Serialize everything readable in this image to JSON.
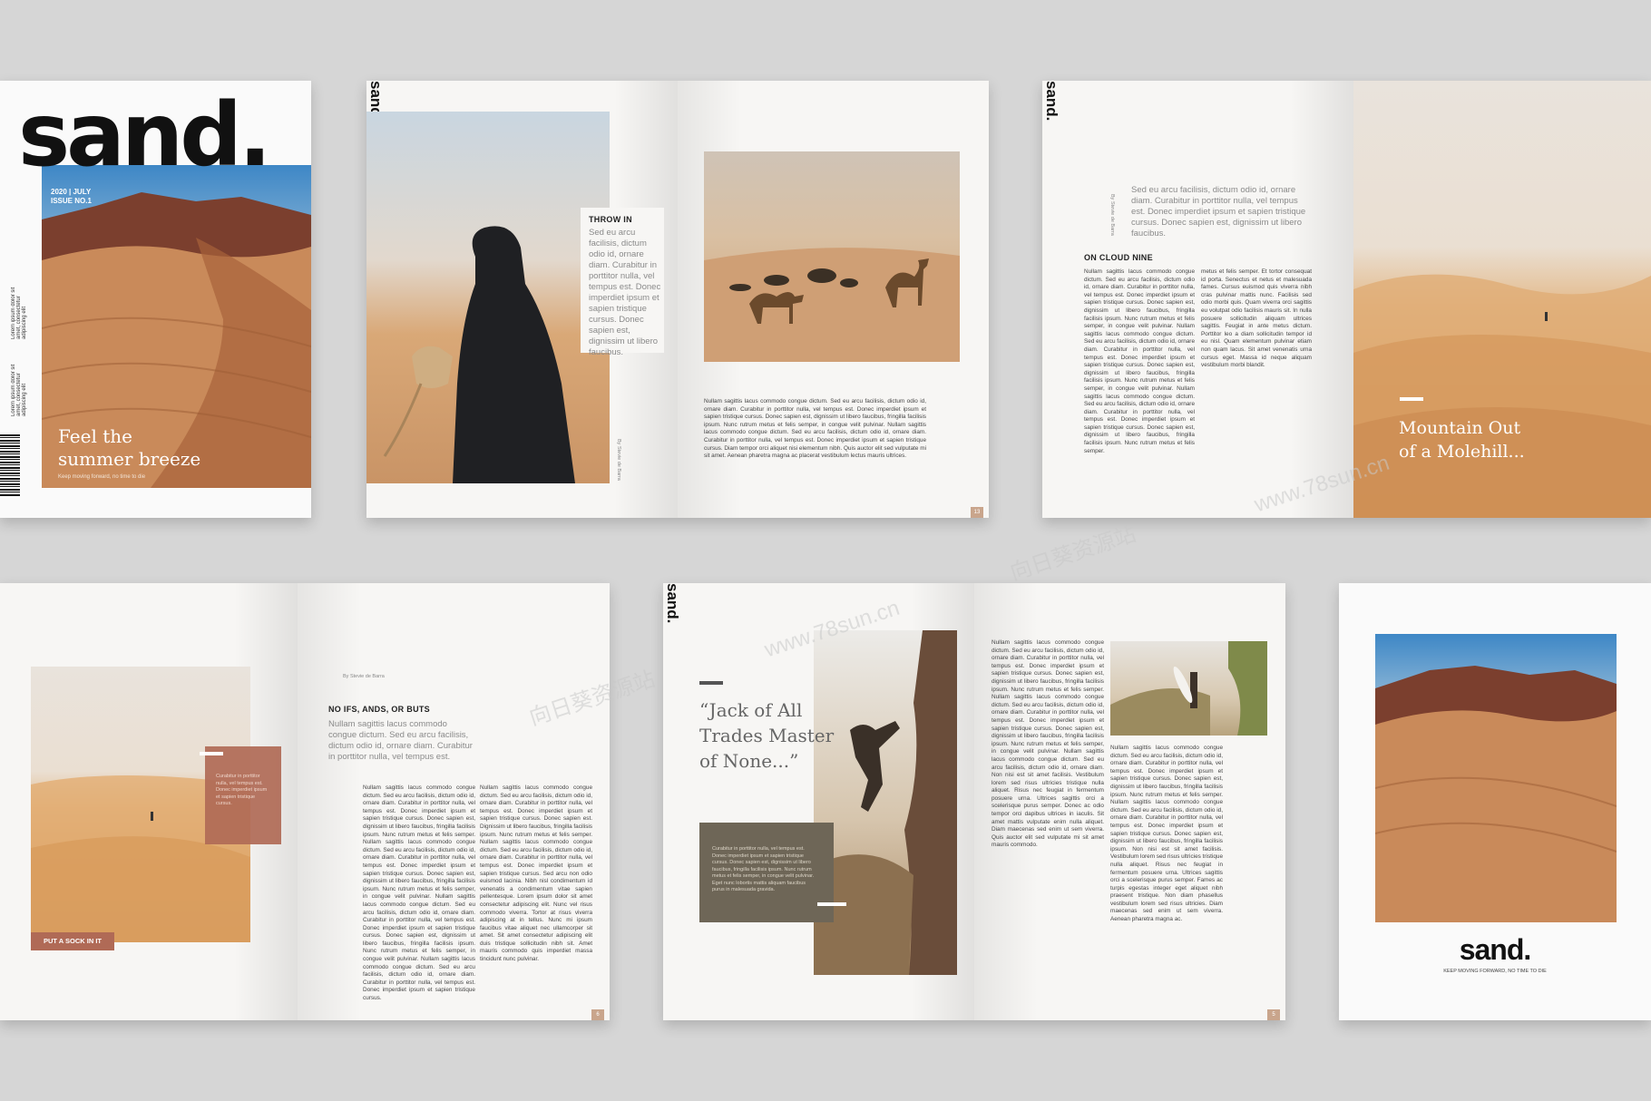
{
  "cover": {
    "masthead": "sand.",
    "issue_line1": "2020 | JULY",
    "issue_line2": "ISSUE NO.1",
    "side_text_1": "Lorem ipsum dolor sit amet, consectetur adipiscing elit",
    "side_text_2": "Lorem ipsum dolor sit amet, consectetur adipiscing elit",
    "headline_line1": "Feel the",
    "headline_line2": "summer breeze",
    "tagline": "Keep moving forward, no time to die"
  },
  "spread1": {
    "spine_logo": "sand.",
    "label": "THROW IN",
    "quote": "Sed eu arcu facilisis, dictum odio id, ornare diam. Curabitur in porttitor nulla, vel tempus est. Donec imperdiet ipsum et sapien tristique cursus. Donec sapien est, dignissim ut libero faucibus.",
    "credit": "By Stevie de Barra",
    "body": "Nullam sagittis lacus commodo congue dictum. Sed eu arcu facilisis, dictum odio id, ornare diam. Curabitur in porttitor nulla, vel tempus est. Donec imperdiet ipsum et sapien tristique cursus. Donec sapien est, dignissim ut libero faucibus, fringilla facilisis ipsum. Nunc rutrum metus et felis semper, in congue velit pulvinar. Nullam sagittis lacus commodo congue dictum. Sed eu arcu facilisis, dictum odio id, ornare diam. Curabitur in porttitor nulla, vel tempus est. Donec imperdiet ipsum et sapien tristique cursus. Diam tempor orci aliquet nisi elementum nibh. Quis auctor elit sed vulputate mi sit amet. Aenean pharetra magna ac placerat vestibulum lectus mauris ultrices.",
    "page_number": "13"
  },
  "spread2": {
    "spine_logo": "sand.",
    "credit": "By Stevie de Barra",
    "intro": "Sed eu arcu facilisis, dictum odio id, ornare diam. Curabitur in porttitor nulla, vel tempus est. Donec imperdiet ipsum et sapien tristique cursus. Donec sapien est, dignissim ut libero faucibus.",
    "label": "ON CLOUD NINE",
    "body_col1": "Nullam sagittis lacus commodo congue dictum. Sed eu arcu facilisis, dictum odio id, ornare diam. Curabitur in porttitor nulla, vel tempus est. Donec imperdiet ipsum et sapien tristique cursus. Donec sapien est, dignissim ut libero faucibus, fringilla facilisis ipsum. Nunc rutrum metus et felis semper, in congue velit pulvinar. Nullam sagittis lacus commodo congue dictum. Sed eu arcu facilisis, dictum odio id, ornare diam. Curabitur in porttitor nulla, vel tempus est. Donec imperdiet ipsum et sapien tristique cursus. Donec sapien est, dignissim ut libero faucibus, fringilla facilisis ipsum. Nunc rutrum metus et felis semper, in congue velit pulvinar. Nullam sagittis lacus commodo congue dictum. Sed eu arcu facilisis, dictum odio id, ornare diam. Curabitur in porttitor nulla, vel tempus est. Donec imperdiet ipsum et sapien tristique cursus. Donec sapien est, dignissim ut libero faucibus, fringilla facilisis ipsum. Nunc rutrum metus et felis semper.",
    "body_col2": "metus et felis semper. Et tortor consequat id porta. Senectus et netus et malesuada fames. Cursus euismod quis viverra nibh cras pulvinar mattis nunc. Facilisis sed odio morbi quis. Quam viverra orci sagittis eu volutpat odio facilisis mauris sit. In nulla posuere sollicitudin aliquam ultrices sagittis. Feugiat in ante metus dictum. Porttitor leo a diam sollicitudin tempor id eu nisl. Quam elementum pulvinar etiam non quam lacus. Sit amet venenatis urna cursus eget. Massa id neque aliquam vestibulum morbi blandit.",
    "headline_line1": "Mountain Out",
    "headline_line2": "of a Molehill..."
  },
  "spread3": {
    "credit": "By Stevie de Barra",
    "label": "NO IFS, ANDS, OR BUTS",
    "intro": "Nullam sagittis lacus commodo congue dictum. Sed eu arcu facilisis, dictum odio id, ornare diam. Curabitur in porttitor nulla, vel tempus est.",
    "caption": "Curabitur in porttitor nulla, vel tempus est. Donec imperdiet ipsum et sapien tristique cursus.",
    "button": "PUT A SOCK IN IT",
    "body_col1": "Nullam sagittis lacus commodo congue dictum. Sed eu arcu facilisis, dictum odio id, ornare diam. Curabitur in porttitor nulla, vel tempus est. Donec imperdiet ipsum et sapien tristique cursus. Donec sapien est, dignissim ut libero faucibus, fringilla facilisis ipsum. Nunc rutrum metus et felis semper. Nullam sagittis lacus commodo congue dictum. Sed eu arcu facilisis, dictum odio id, ornare diam. Curabitur in porttitor nulla, vel tempus est. Donec imperdiet ipsum et sapien tristique cursus. Donec sapien est, dignissim ut libero faucibus, fringilla facilisis ipsum. Nunc rutrum metus et felis semper, in congue velit pulvinar. Nullam sagittis lacus commodo congue dictum. Sed eu arcu facilisis, dictum odio id, ornare diam. Curabitur in porttitor nulla, vel tempus est. Donec imperdiet ipsum et sapien tristique cursus. Donec sapien est, dignissim ut libero faucibus, fringilla facilisis ipsum. Nunc rutrum metus et felis semper, in congue velit pulvinar. Nullam sagittis lacus commodo congue dictum. Sed eu arcu facilisis, dictum odio id, ornare diam. Curabitur in porttitor nulla, vel tempus est. Donec imperdiet ipsum et sapien tristique cursus.",
    "body_col2": "Nullam sagittis lacus commodo congue dictum. Sed eu arcu facilisis, dictum odio id, ornare diam. Curabitur in porttitor nulla, vel tempus est. Donec imperdiet ipsum et sapien tristique cursus. Donec sapien est. Dignissim ut libero faucibus, fringilla facilisis ipsum. Nunc rutrum metus et felis semper. Nullam sagittis lacus commodo congue dictum. Sed eu arcu facilisis, dictum odio id, ornare diam. Curabitur in porttitor nulla, vel tempus est. Donec imperdiet ipsum et sapien tristique cursus. Sed arcu non odio euismod lacinia. Nibh nisl condimentum id venenatis a condimentum vitae sapien pellentesque. Lorem ipsum dolor sit amet consectetur adipiscing elit. Nunc vel risus commodo viverra. Tortor at risus viverra adipiscing at in tellus. Nunc mi ipsum faucibus vitae aliquet nec ullamcorper sit amet. Sit amet consectetur adipiscing elit duis tristique sollicitudin nibh sit. Amet mauris commodo quis imperdiet massa tincidunt nunc pulvinar.",
    "page_number": "6"
  },
  "spread4": {
    "spine_logo": "sand.",
    "quote_line1": "“Jack of All",
    "quote_line2": "Trades Master",
    "quote_line3": "of None...”",
    "caption": "Curabitur in porttitor nulla, vel tempus est. Donec imperdiet ipsum et sapien tristique cursus. Donec sapien est, dignissim ut libero faucibus, fringilla facilisis ipsum. Nunc rutrum metus et felis semper, in congue velit pulvinar. Eget nunc lobortis mattis aliquam faucibus purus in malesuada gravida.",
    "body_col1": "Nullam sagittis lacus commodo congue dictum. Sed eu arcu facilisis, dictum odio id, ornare diam. Curabitur in porttitor nulla, vel tempus est. Donec imperdiet ipsum et sapien tristique cursus. Donec sapien est, dignissim ut libero faucibus, fringilla facilisis ipsum. Nunc rutrum metus et felis semper. Nullam sagittis lacus commodo congue dictum. Sed eu arcu facilisis, dictum odio id, ornare diam. Curabitur in porttitor nulla, vel tempus est. Donec imperdiet ipsum et sapien tristique cursus. Donec sapien est, dignissim ut libero faucibus, fringilla facilisis ipsum. Nunc rutrum metus et felis semper, in congue velit pulvinar. Nullam sagittis lacus commodo congue dictum. Sed eu arcu facilisis, dictum odio id, ornare diam. Non nisi est sit amet facilisis. Vestibulum lorem sed risus ultricies tristique nulla aliquet. Risus nec feugiat in fermentum posuere urna. Ultrices sagittis orci a scelerisque purus semper. Donec ac odio tempor orci dapibus ultrices in iaculis. Sit amet mattis vulputate enim nulla aliquet. Diam maecenas sed enim ut sem viverra. Quis auctor elit sed vulputate mi sit amet mauris commodo.",
    "body_col2": "Nullam sagittis lacus commodo congue dictum. Sed eu arcu facilisis, dictum odio id, ornare diam. Curabitur in porttitor nulla, vel tempus est. Donec imperdiet ipsum et sapien tristique cursus. Donec sapien est, dignissim ut libero faucibus, fringilla facilisis ipsum. Nunc rutrum metus et felis semper. Nullam sagittis lacus commodo congue dictum. Sed eu arcu facilisis, dictum odio id, ornare diam. Curabitur in porttitor nulla, vel tempus est. Donec imperdiet ipsum et sapien tristique cursus. Donec sapien est, dignissim ut libero faucibus, fringilla facilisis ipsum. Non nisi est sit amet facilisis. Vestibulum lorem sed risus ultricies tristique nulla aliquet. Risus nec feugiat in fermentum posuere urna. Ultrices sagittis orci a scelerisque purus semper. Fames ac turpis egestas integer eget aliquet nibh praesent tristique. Non diam phasellus vestibulum lorem sed risus ultricies. Diam maecenas sed enim ut sem viverra. Aenean pharetra magna ac.",
    "page_number": "5"
  },
  "back_cover": {
    "logo": "sand.",
    "tagline": "KEEP MOVING FORWARD, NO TIME TO DIE"
  },
  "watermark": {
    "line1": "向日葵资源站",
    "line2": "www.78sun.cn"
  }
}
